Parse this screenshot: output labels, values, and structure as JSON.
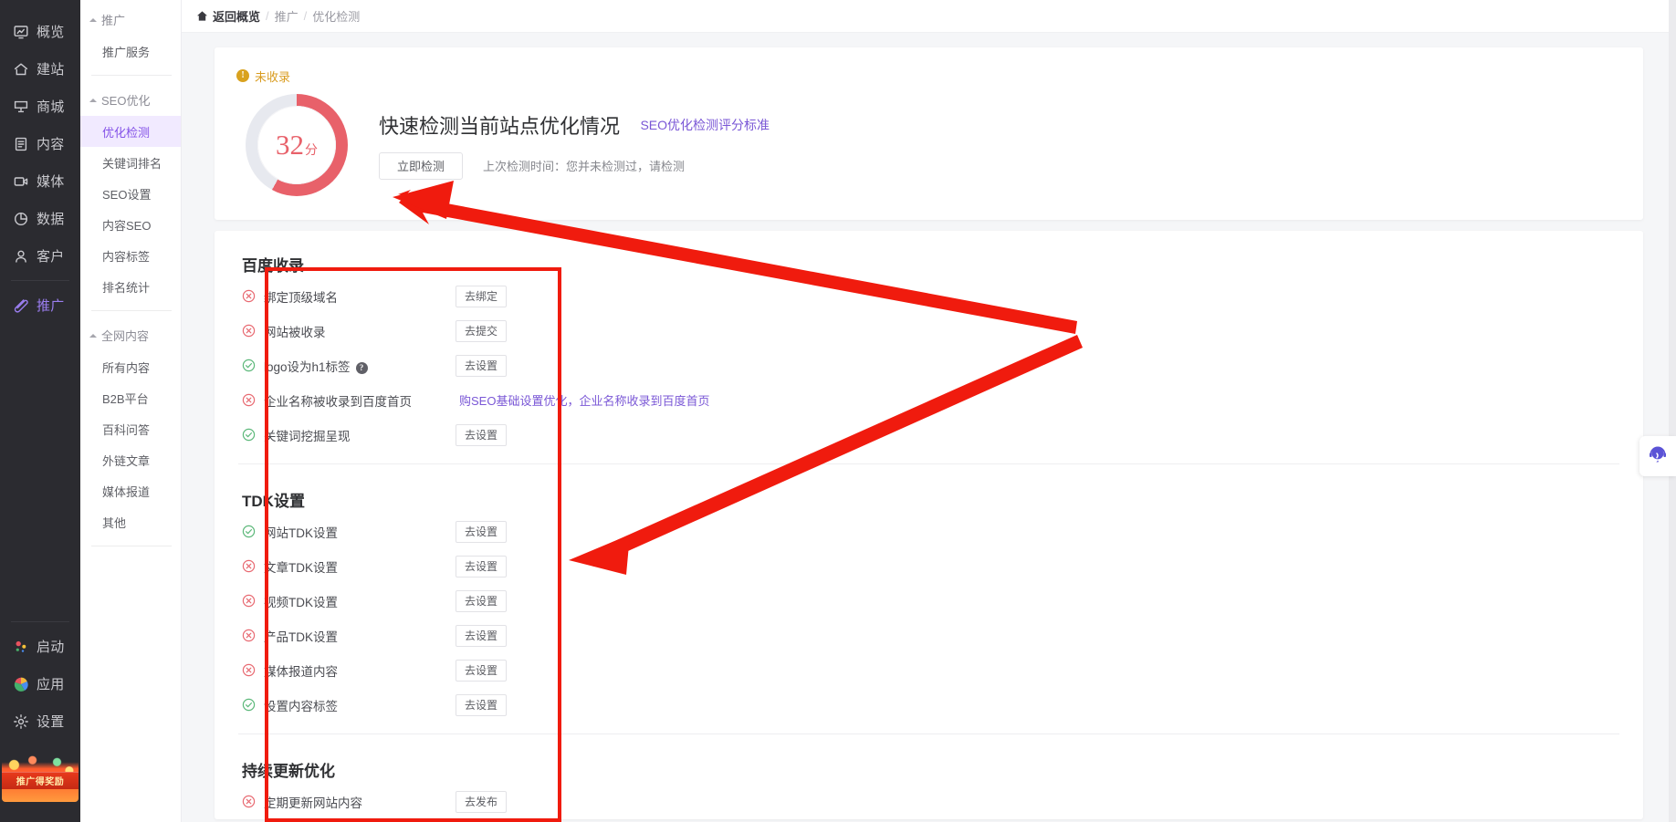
{
  "rail": {
    "items": [
      {
        "label": "概览",
        "icon": "overview-icon"
      },
      {
        "label": "建站",
        "icon": "home-icon"
      },
      {
        "label": "商城",
        "icon": "cart-icon"
      },
      {
        "label": "内容",
        "icon": "document-icon"
      },
      {
        "label": "媒体",
        "icon": "video-icon"
      },
      {
        "label": "数据",
        "icon": "pie-chart-icon"
      },
      {
        "label": "客户",
        "icon": "user-icon"
      },
      {
        "label": "推广",
        "icon": "megaphone-icon",
        "active": true
      }
    ],
    "bottom_items": [
      {
        "label": "启动",
        "icon": "launch-icon"
      },
      {
        "label": "应用",
        "icon": "apps-icon"
      },
      {
        "label": "设置",
        "icon": "gear-icon"
      }
    ],
    "promo_label": "推广得奖励"
  },
  "submenu": {
    "groups": [
      {
        "title": "推广",
        "items": [
          {
            "label": "推广服务"
          }
        ]
      },
      {
        "title": "SEO优化",
        "items": [
          {
            "label": "优化检测",
            "active": true
          },
          {
            "label": "关键词排名"
          },
          {
            "label": "SEO设置"
          },
          {
            "label": "内容SEO"
          },
          {
            "label": "内容标签"
          },
          {
            "label": "排名统计"
          }
        ]
      },
      {
        "title": "全网内容",
        "items": [
          {
            "label": "所有内容"
          },
          {
            "label": "B2B平台"
          },
          {
            "label": "百科问答"
          },
          {
            "label": "外链文章"
          },
          {
            "label": "媒体报道"
          },
          {
            "label": "其他"
          }
        ]
      }
    ]
  },
  "breadcrumb": {
    "home": "返回概览",
    "sep": "/",
    "items": [
      "推广",
      "优化检测"
    ]
  },
  "score_card": {
    "badge": "未收录",
    "badge_glyph": "!",
    "score": "32",
    "score_unit": "分",
    "score_percent": 58,
    "ring_color": "#e8616a",
    "ring_track": "#e7e9ef",
    "title": "快速检测当前站点优化情况",
    "link": "SEO优化检测评分标准",
    "detect_button": "立即检测",
    "last_check": "上次检测时间：您并未检测过，请检测"
  },
  "sections": [
    {
      "title": "百度收录",
      "rows": [
        {
          "status": "fail",
          "label": "绑定顶级域名",
          "action": "去绑定",
          "type": "button"
        },
        {
          "status": "fail",
          "label": "网站被收录",
          "action": "去提交",
          "type": "button"
        },
        {
          "status": "ok",
          "label": "logo设为h1标签",
          "help": "?",
          "action": "去设置",
          "type": "button"
        },
        {
          "status": "fail",
          "label": "企业名称被收录到百度首页",
          "action": "购SEO基础设置优化，企业名称收录到百度首页",
          "type": "link"
        },
        {
          "status": "ok",
          "label": "关键词挖掘呈现",
          "action": "去设置",
          "type": "button"
        }
      ]
    },
    {
      "title": "TDK设置",
      "rows": [
        {
          "status": "ok",
          "label": "网站TDK设置",
          "action": "去设置",
          "type": "button"
        },
        {
          "status": "fail",
          "label": "文章TDK设置",
          "action": "去设置",
          "type": "button"
        },
        {
          "status": "fail",
          "label": "视频TDK设置",
          "action": "去设置",
          "type": "button"
        },
        {
          "status": "fail",
          "label": "产品TDK设置",
          "action": "去设置",
          "type": "button"
        },
        {
          "status": "fail",
          "label": "媒体报道内容",
          "action": "去设置",
          "type": "button"
        },
        {
          "status": "ok",
          "label": "设置内容标签",
          "action": "去设置",
          "type": "button"
        }
      ]
    },
    {
      "title": "持续更新优化",
      "rows": [
        {
          "status": "fail",
          "label": "定期更新网站内容",
          "action": "去发布",
          "type": "button"
        }
      ]
    }
  ],
  "annotation": {
    "color": "#f01b0e",
    "shapes": [
      "highlight-rectangle",
      "arrow-to-score-ring",
      "arrow-to-tdk-section"
    ]
  },
  "service_widget": {
    "icon": "headset-icon",
    "color": "#5b53d6"
  }
}
